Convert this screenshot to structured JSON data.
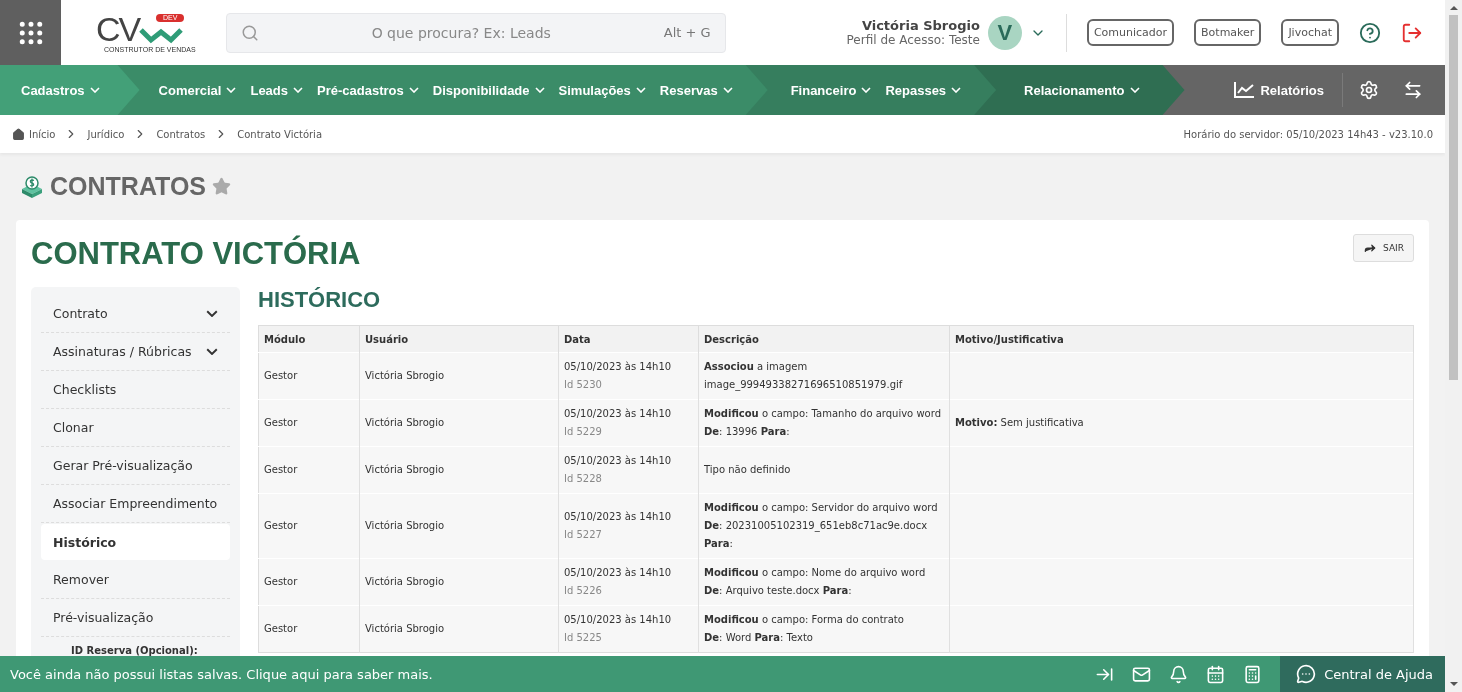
{
  "header": {
    "logo": {
      "mark": "CV",
      "badge": "DEV",
      "tagline": "CONSTRUTOR DE VENDAS"
    },
    "search": {
      "placeholder": "O que procura? Ex: Leads",
      "shortcut": "Alt + G"
    },
    "user": {
      "name": "Victória Sbrogio",
      "profile": "Perfil de Acesso: Teste",
      "initial": "V"
    },
    "buttons": [
      "Comunicador",
      "Botmaker",
      "Jivochat"
    ]
  },
  "nav": {
    "segments": [
      {
        "color": "#43a078",
        "items": [
          "Cadastros"
        ]
      },
      {
        "color": "#3b8c68",
        "items": [
          "Comercial",
          "Leads",
          "Pré-cadastros",
          "Disponibilidade",
          "Simulações",
          "Reservas"
        ]
      },
      {
        "color": "#367e5e",
        "items": [
          "Financeiro",
          "Repasses"
        ]
      },
      {
        "color": "#2f6e52",
        "items": [
          "Relacionamento"
        ]
      }
    ],
    "reports": "Relatórios"
  },
  "breadcrumb": {
    "items": [
      "Início",
      "Jurídico",
      "Contratos",
      "Contrato Victória"
    ],
    "server_time": "Horário do servidor: 05/10/2023 14h43 - v23.10.0"
  },
  "page": {
    "title": "CONTRATOS",
    "favorite": false
  },
  "card": {
    "title": "CONTRATO VICTÓRIA",
    "exit_button": "SAIR",
    "sidebar": {
      "items": [
        {
          "label": "Contrato",
          "kind": "group",
          "selected": false
        },
        {
          "label": "Assinaturas / Rúbricas",
          "kind": "group",
          "selected": false
        },
        {
          "label": "Checklists",
          "kind": "link",
          "selected": false
        },
        {
          "label": "Clonar",
          "kind": "link",
          "selected": false
        },
        {
          "label": "Gerar Pré-visualização",
          "kind": "link",
          "selected": false
        },
        {
          "label": "Associar Empreendimento",
          "kind": "link",
          "selected": false
        },
        {
          "label": "Histórico",
          "kind": "link",
          "selected": true
        },
        {
          "label": "Remover",
          "kind": "link",
          "selected": false
        },
        {
          "label": "Pré-visualização",
          "kind": "link",
          "selected": false
        }
      ],
      "field_label": "ID Reserva (Opcional):"
    },
    "section_title": "HISTÓRICO",
    "table": {
      "columns": [
        "Módulo",
        "Usuário",
        "Data",
        "Descrição",
        "Motivo/Justificativa"
      ],
      "rows": [
        {
          "module": "Gestor",
          "user": "Victória Sbrogio",
          "date": "05/10/2023 às 14h10",
          "id": "Id 5230",
          "description": [
            "**Associou** a imagem image_99949338271696510851979.gif"
          ],
          "reason": ""
        },
        {
          "module": "Gestor",
          "user": "Victória Sbrogio",
          "date": "05/10/2023 às 14h10",
          "id": "Id 5229",
          "description": [
            "**Modificou** o campo: Tamanho do arquivo word",
            "**De**: 13996 **Para**:"
          ],
          "reason": "**Motivo:** Sem justificativa"
        },
        {
          "module": "Gestor",
          "user": "Victória Sbrogio",
          "date": "05/10/2023 às 14h10",
          "id": "Id 5228",
          "description": [
            "Tipo não definido"
          ],
          "reason": ""
        },
        {
          "module": "Gestor",
          "user": "Victória Sbrogio",
          "date": "05/10/2023 às 14h10",
          "id": "Id 5227",
          "description": [
            "**Modificou** o campo: Servidor do arquivo word",
            "**De**: 20231005102319_651eb8c71ac9e.docx",
            "**Para**:"
          ],
          "reason": ""
        },
        {
          "module": "Gestor",
          "user": "Victória Sbrogio",
          "date": "05/10/2023 às 14h10",
          "id": "Id 5226",
          "description": [
            "**Modificou** o campo: Nome do arquivo word",
            "**De**: Arquivo teste.docx **Para**:"
          ],
          "reason": ""
        },
        {
          "module": "Gestor",
          "user": "Victória Sbrogio",
          "date": "05/10/2023 às 14h10",
          "id": "Id 5225",
          "description": [
            "**Modificou** o campo: Forma do contrato",
            "**De**: Word **Para**: Texto"
          ],
          "reason": ""
        }
      ]
    }
  },
  "footer": {
    "message": "Você ainda não possui listas salvas. Clique aqui para saber mais.",
    "help": "Central de Ajuda"
  }
}
